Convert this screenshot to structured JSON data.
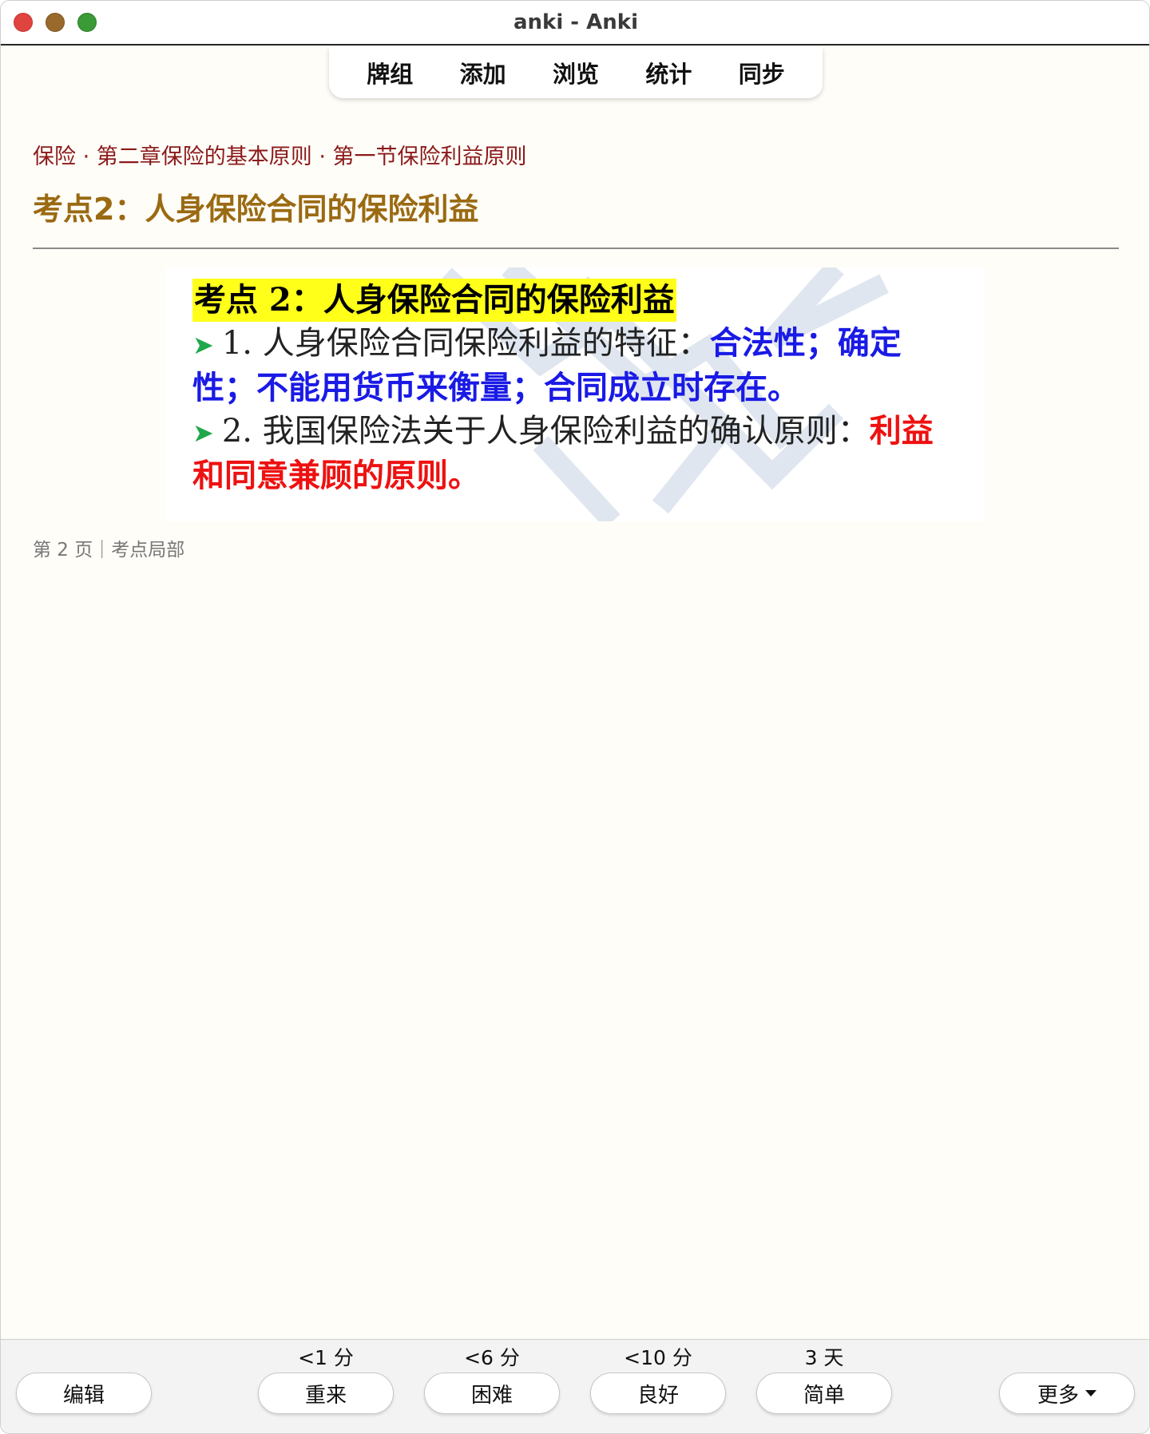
{
  "window": {
    "title": "anki - Anki"
  },
  "toolbar": {
    "items": [
      "牌组",
      "添加",
      "浏览",
      "统计",
      "同步"
    ]
  },
  "card": {
    "breadcrumb": "保险 · 第二章保险的基本原则 · 第一节保险利益原则",
    "title": "考点2：人身保险合同的保险利益",
    "slide": {
      "heading": "考点 2：人身保险合同的保险利益",
      "line1_prefix": "1.  人身保险合同保险利益的特征：",
      "line1_highlight": "合法性；确定性；不能用货币来衡量；合同成立时存在。",
      "line2_prefix": "2.  我国保险法关于人身保险利益的确认原则：",
      "line2_highlight": "利益和同意兼顾的原则。",
      "arrow": "➤"
    },
    "footer": "第 2 页｜考点局部"
  },
  "answer_bar": {
    "edit_label": "编辑",
    "more_label": "更多",
    "buttons": [
      {
        "interval": "<1 分",
        "label": "重来"
      },
      {
        "interval": "<6 分",
        "label": "困难"
      },
      {
        "interval": "<10 分",
        "label": "良好"
      },
      {
        "interval": "3 天",
        "label": "简单"
      }
    ]
  }
}
